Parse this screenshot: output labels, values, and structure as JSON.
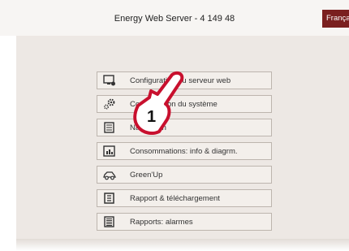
{
  "header": {
    "title": "Energy Web Server - 4 149 48",
    "language_button": "Français"
  },
  "menu": {
    "items": [
      {
        "label": "Configuration du serveur web",
        "icon": "monitor-settings-icon"
      },
      {
        "label": "Configuration du système",
        "icon": "gears-icon"
      },
      {
        "label": "Navigation",
        "icon": "book-icon"
      },
      {
        "label": "Consommations: info & diagrm.",
        "icon": "chart-icon"
      },
      {
        "label": "Green'Up",
        "icon": "car-icon"
      },
      {
        "label": "Rapport & téléchargement",
        "icon": "report-download-icon"
      },
      {
        "label": "Rapports: alarmes",
        "icon": "alarm-report-icon"
      }
    ]
  },
  "callout": {
    "number": "1",
    "icon": "pointing-hand-icon"
  },
  "colors": {
    "brand": "#7a1f1f",
    "panel": "#ede8e4",
    "button_bg": "#f3efeb",
    "button_border": "#bdb5ae",
    "callout": "#c8102e"
  }
}
